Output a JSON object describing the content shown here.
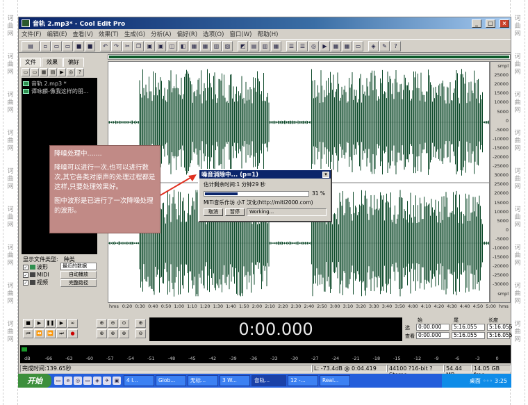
{
  "watermark": {
    "chars": [
      "诃",
      "曲",
      "网"
    ]
  },
  "window": {
    "title": "音轨 2.mp3* - Cool Edit Pro",
    "min": "_",
    "max": "□",
    "close": "×"
  },
  "menu": [
    "文件(F)",
    "编辑(E)",
    "查看(V)",
    "效果(T)",
    "生成(G)",
    "分析(A)",
    "偏好(R)",
    "选项(O)",
    "窗口(W)",
    "帮助(H)"
  ],
  "panel": {
    "tabs": [
      "文件",
      "效果",
      "偏好"
    ],
    "files": [
      "音轨 2.mp3 *",
      "谭咏麟-像我这样的朋..."
    ],
    "filetype_label": "显示文件类型:",
    "filetype_kind": "种类",
    "types": [
      "波形",
      "MIDI",
      "视频"
    ],
    "sort_value": "最近的数据",
    "btn_auto": "自动播放",
    "btn_full": "完整路径"
  },
  "annotation": {
    "p1": "降噪处理中.......",
    "p2": "降噪可以进行一次,也可以进行数次,其它各类对原声的处理过程都是这样,只要处理效果好。",
    "p3": "图中波形是已进行了一次降噪处理的波形。"
  },
  "dialog": {
    "title": "噪音消除中... (p=1)",
    "remaining": "估计剩余时间:1 分钟29 秒",
    "percent": "31 %",
    "progress": 0.31,
    "credit": "MiTi音乐作坊 小T 汉化(http://miti2000.com)",
    "btn_cancel": "取消",
    "btn_pause": "暂停",
    "status": "Working..."
  },
  "ruler_y": [
    "smpl",
    "25000",
    "20000",
    "15000",
    "10000",
    "5000",
    "0",
    "-5000",
    "-10000",
    "-15000",
    "-20000",
    "-25000",
    "30000",
    "25000",
    "20000",
    "15000",
    "10000",
    "5000",
    "0",
    "-5000",
    "-10000",
    "-15000",
    "-20000",
    "-25000",
    "-30000",
    "smpl"
  ],
  "ruler_x": [
    "hms",
    "0:20",
    "0:30",
    "0:40",
    "0:50",
    "1:00",
    "1:10",
    "1:20",
    "1:30",
    "1:40",
    "1:50",
    "2:00",
    "2:10",
    "2:20",
    "2:30",
    "2:40",
    "2:50",
    "3:00",
    "3:10",
    "3:20",
    "3:30",
    "3:40",
    "3:50",
    "4:00",
    "4:10",
    "4:20",
    "4:30",
    "4:40",
    "4:50",
    "5:00",
    "hms"
  ],
  "transport": {
    "time": "0:00.000",
    "sel_row": "选",
    "view_row": "查看",
    "col_start": "始",
    "col_end": "尾",
    "col_len": "长度",
    "sel_start": "0:00.000",
    "sel_end": "5:16.055",
    "sel_len": "5:16.055",
    "view_start": "0:00.000",
    "view_end": "5:16.055",
    "view_len": "5:16.055"
  },
  "levels": [
    "dB",
    "-66",
    "-63",
    "-60",
    "-57",
    "-54",
    "-51",
    "-48",
    "-45",
    "-42",
    "-39",
    "-36",
    "-33",
    "-30",
    "-27",
    "-24",
    "-21",
    "-18",
    "-15",
    "-12",
    "-9",
    "-6",
    "-3",
    "0"
  ],
  "status": {
    "done": "完成时间:139.65秒",
    "pos": "L: -73.4dB @  0:04.419",
    "format": "44100 ?16-bit ?Stereo",
    "size": "54.44 MB",
    "free": "14.05 GB free"
  },
  "taskbar": {
    "start": "开始",
    "tasks": [
      "4 I...",
      "Glob...",
      "无标...",
      "3 W...",
      "音轨...",
      "12 -...",
      "Real..."
    ],
    "tray_text": "桌面",
    "clock": "3:25"
  },
  "colors": {
    "wave": "#0d4a2a",
    "annotation_bg": "#c18a86",
    "title_blue": "#0a246a"
  }
}
